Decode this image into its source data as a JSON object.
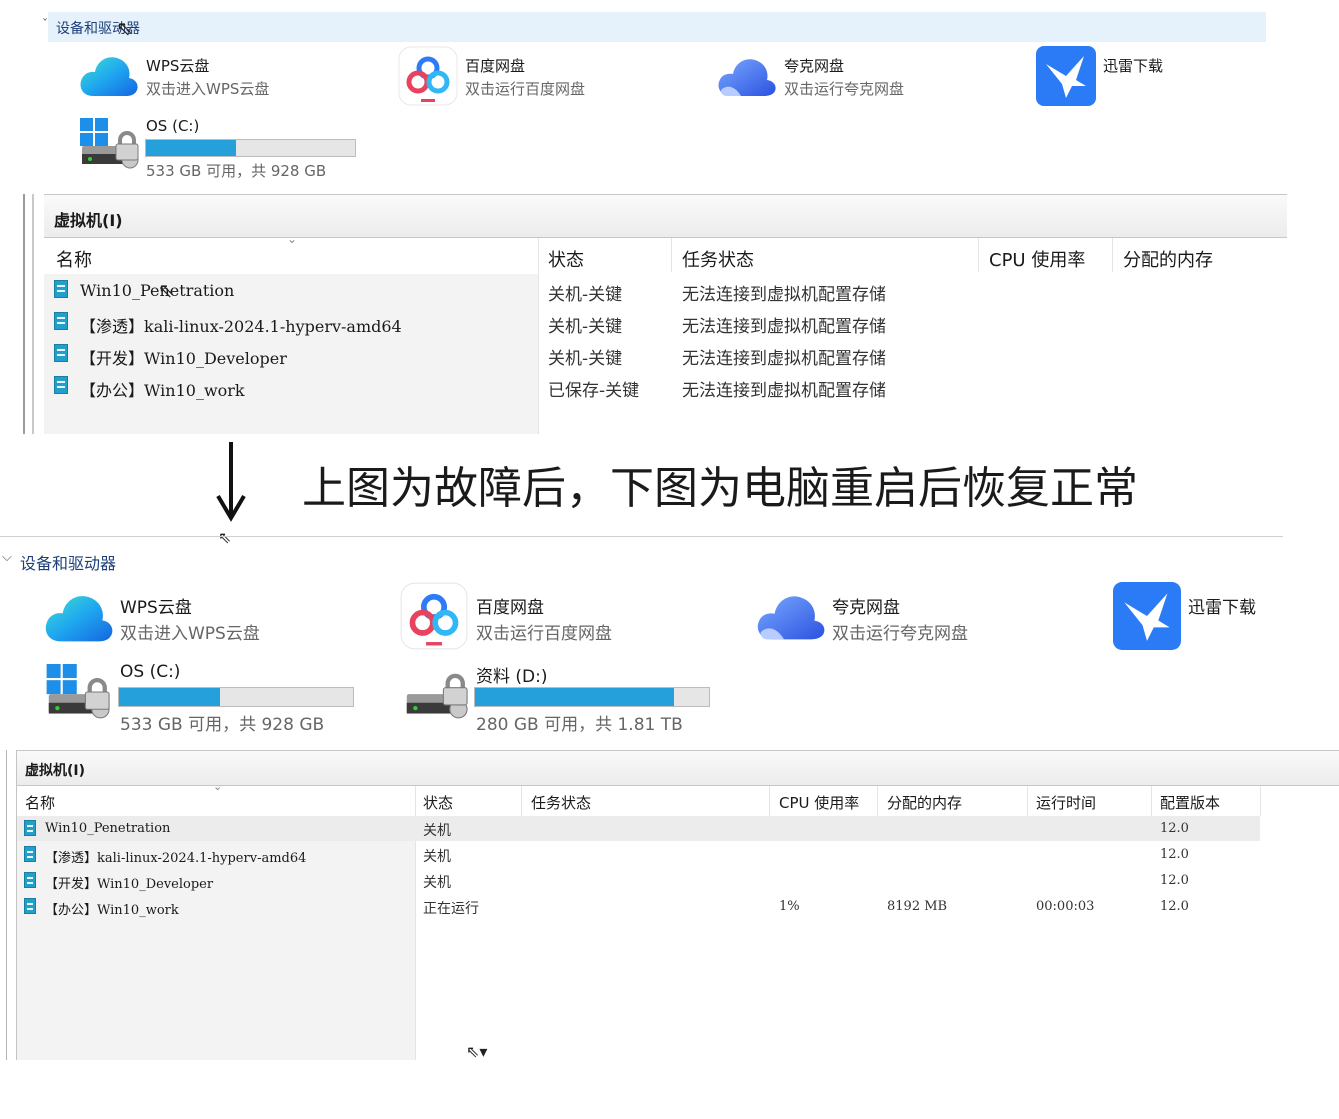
{
  "top": {
    "section_label": "设备和驱动器",
    "apps": [
      {
        "name": "WPS云盘",
        "desc": "双击进入WPS云盘",
        "icon": "wps-cloud-icon"
      },
      {
        "name": "百度网盘",
        "desc": "双击运行百度网盘",
        "icon": "baidu-netdisk-icon"
      },
      {
        "name": "夸克网盘",
        "desc": "双击运行夸克网盘",
        "icon": "quark-cloud-icon"
      },
      {
        "name": "迅雷下载",
        "desc": "",
        "icon": "xunlei-icon"
      }
    ],
    "drives": [
      {
        "name": "OS (C:)",
        "info": "533 GB 可用，共 928 GB",
        "used_fraction": 0.43
      }
    ],
    "vm_title": "虚拟机(I)",
    "columns": [
      "名称",
      "状态",
      "任务状态",
      "CPU 使用率",
      "分配的内存"
    ],
    "rows": [
      {
        "name": "Win10_Penetration",
        "state": "关机-关键",
        "task": "无法连接到虚拟机配置存储"
      },
      {
        "name": "【渗透】kali-linux-2024.1-hyperv-amd64",
        "state": "关机-关键",
        "task": "无法连接到虚拟机配置存储"
      },
      {
        "name": "【开发】Win10_Developer",
        "state": "关机-关键",
        "task": "无法连接到虚拟机配置存储"
      },
      {
        "name": "【办公】Win10_work",
        "state": "已保存-关键",
        "task": "无法连接到虚拟机配置存储"
      }
    ]
  },
  "note": "上图为故障后，下图为电脑重启后恢复正常",
  "bottom": {
    "section_label": "设备和驱动器",
    "apps": [
      {
        "name": "WPS云盘",
        "desc": "双击进入WPS云盘",
        "icon": "wps-cloud-icon"
      },
      {
        "name": "百度网盘",
        "desc": "双击运行百度网盘",
        "icon": "baidu-netdisk-icon"
      },
      {
        "name": "夸克网盘",
        "desc": "双击运行夸克网盘",
        "icon": "quark-cloud-icon"
      },
      {
        "name": "迅雷下载",
        "desc": "",
        "icon": "xunlei-icon"
      }
    ],
    "drives": [
      {
        "name": "OS (C:)",
        "info": "533 GB 可用，共 928 GB",
        "used_fraction": 0.43
      },
      {
        "name": "资料 (D:)",
        "info": "280 GB 可用，共 1.81 TB",
        "used_fraction": 0.85
      }
    ],
    "vm_title": "虚拟机(I)",
    "columns": [
      "名称",
      "状态",
      "任务状态",
      "CPU 使用率",
      "分配的内存",
      "运行时间",
      "配置版本"
    ],
    "rows": [
      {
        "name": "Win10_Penetration",
        "state": "关机",
        "task": "",
        "cpu": "",
        "mem": "",
        "uptime": "",
        "version": "12.0"
      },
      {
        "name": "【渗透】kali-linux-2024.1-hyperv-amd64",
        "state": "关机",
        "task": "",
        "cpu": "",
        "mem": "",
        "uptime": "",
        "version": "12.0"
      },
      {
        "name": "【开发】Win10_Developer",
        "state": "关机",
        "task": "",
        "cpu": "",
        "mem": "",
        "uptime": "",
        "version": "12.0"
      },
      {
        "name": "【办公】Win10_work",
        "state": "正在运行",
        "task": "",
        "cpu": "1%",
        "mem": "8192 MB",
        "uptime": "00:00:03",
        "version": "12.0"
      }
    ]
  }
}
